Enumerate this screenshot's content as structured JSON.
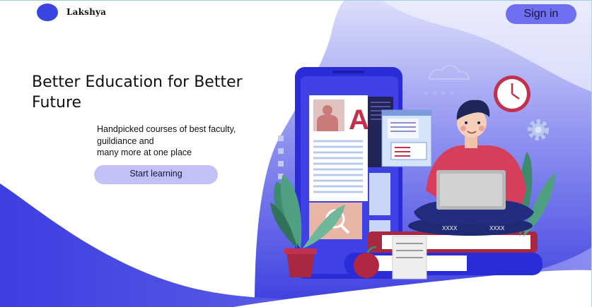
{
  "header": {
    "brand_name": "Lakshya",
    "signin_label": "Sign in"
  },
  "hero": {
    "headline": "Better Education for Better Future",
    "subtext": "Handpicked courses of best faculty, guildiance and\nmany more at one place",
    "cta_label": "Start learning"
  },
  "illustration": {
    "book_letter": "A",
    "cushion_text": "XXXX"
  },
  "colors": {
    "accent": "#6f6ff2",
    "logo": "#3a44e0",
    "cta_bg": "#c2c0f7",
    "wave": "#4b4de3",
    "wave_light": "#e6e7fc"
  }
}
